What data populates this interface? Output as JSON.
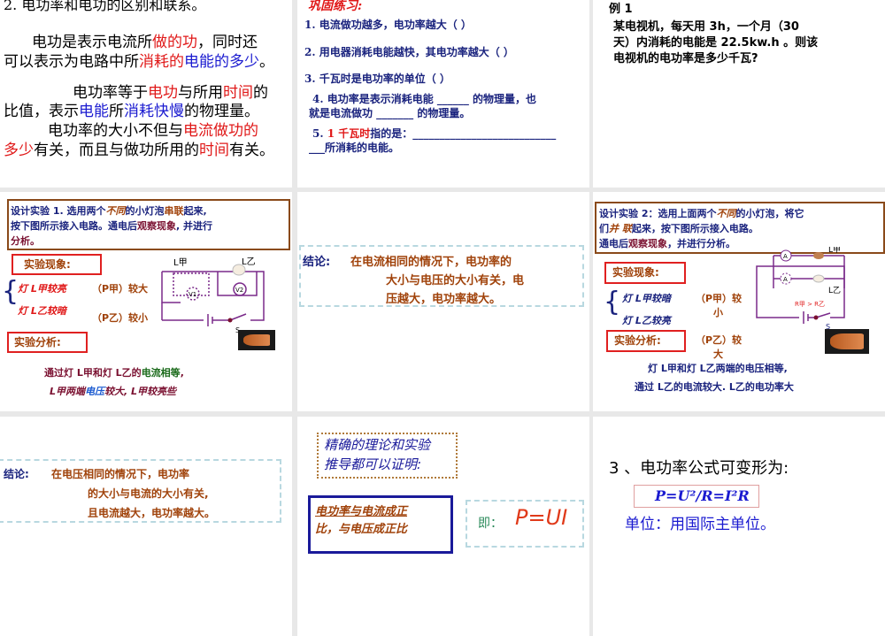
{
  "slide1": {
    "title": "2. 电功率和电功的区别和联系。",
    "p1_a": "电功是表示电流所",
    "p1_b": "做的功",
    "p1_c": "，同时还",
    "p1_d": "可以表示为电路中所",
    "p1_e": "消耗的",
    "p1_f": "电能的多少",
    "p1_g": "。",
    "p2_a": "电功率等于",
    "p2_b": "电功",
    "p2_c": "与所用",
    "p2_d": "时间",
    "p2_e": "的",
    "p2_f": "比值，表示",
    "p2_g": "电能",
    "p2_h": "所",
    "p2_i": "消耗快慢",
    "p2_j": "的物理量。",
    "p3_a": "电功率的大小不但与",
    "p3_b": "电流做功的",
    "p3_c": "多少",
    "p3_d": "有关，而且与做功所用的",
    "p3_e": "时间",
    "p3_f": "有关。"
  },
  "slide2": {
    "heading": "巩固练习:",
    "q1": "1. 电流做功越多，电功率越大（       ）",
    "q2": "2. 用电器消耗电能越快，其电功率越大（     ）",
    "q3": "3. 千瓦时是电功率的单位（     ）",
    "q4a": "4. 电功率是表示消耗电能 ______ 的物理量，也",
    "q4b": "就是电流做功 _______ 的物理量。",
    "q5_num": "5.",
    "q5_red": "1 千瓦时",
    "q5_rest": "指的是：___________________________",
    "q5b": "___所消耗的电能。"
  },
  "slide3": {
    "label": "例 1",
    "line1": "某电视机，每天用 3h，一个月（30",
    "line2": "天）内消耗的电能是 22.5kw.h 。则该",
    "line3": "电视机的电功率是多少千瓦?"
  },
  "slide4": {
    "design_a": "设计实验 1.  选用两个",
    "design_b": "不同",
    "design_c": "的小灯泡",
    "design_d": "串联",
    "design_e": "起来,",
    "design_f": "按下图所示接入电路。通电后",
    "design_g": "观察现象",
    "design_h": ", 并进行",
    "design_i": "分析。",
    "phenomenon_label": "实验现象:",
    "obs1": "灯 L甲较亮",
    "obs2": "灯 L乙较暗",
    "p1": "（P甲）较大",
    "p2": "（P乙）较小",
    "analysis_label": "实验分析:",
    "an1_a": "通过灯 L甲和灯 L乙的",
    "an1_b": "电流相等",
    "an1_c": ",",
    "an2_a": "L甲两端",
    "an2_b": "电压",
    "an2_c": "较大,    L甲较亮些",
    "circuit": {
      "l1": "L甲",
      "l2": "L乙",
      "v1": "V1",
      "v2": "V2",
      "s": "S"
    }
  },
  "slide5": {
    "label": "结论:",
    "line1": "在电流相同的情况下，电功率的",
    "line2": "大小与电压的大小有关，电",
    "line3": "压越大，电功率越大。"
  },
  "slide6": {
    "design_a": "设计实验 2：选用上面两个",
    "design_b": "不同",
    "design_c": "的小灯泡，将它",
    "design_d": "们",
    "design_e": "并 联",
    "design_f": "起来，按下图所示接入电路。",
    "design_g": "通电后",
    "design_h": "观察现象",
    "design_i": "，并进行分析。",
    "phenomenon_label": "实验现象:",
    "obs1": "灯 L甲较暗",
    "obs2": "灯 L乙较亮",
    "p1a": "（P甲）较",
    "p1b": "小",
    "p2a": "（P乙）较",
    "p2b": "大",
    "analysis_label": "实验分析:",
    "an1": "灯 L甲和灯 L乙两端的电压相等,",
    "an2": "通过 L乙的电流较大. L乙的电功率大",
    "circuit": {
      "l1": "L甲",
      "l2": "L乙",
      "a": "A",
      "r": "R甲 > R乙",
      "s": "S"
    }
  },
  "slide7": {
    "label": "结论:",
    "line1": "在电压相同的情况下，电功率",
    "line2": "的大小与电流的大小有关,",
    "line3": "且电流越大，电功率越大。"
  },
  "slide8": {
    "proof1": "精确的理论和实验",
    "proof2": "推导都可以证明:",
    "box1": "电功率与电流成正",
    "box2": "比，与电压成正比",
    "ji": "即：",
    "formula": "P=UI"
  },
  "slide9": {
    "heading": "3 、电功率公式可变形为:",
    "formula": "P=U²/R=I²R",
    "unit": "单位：用国际主单位。"
  }
}
